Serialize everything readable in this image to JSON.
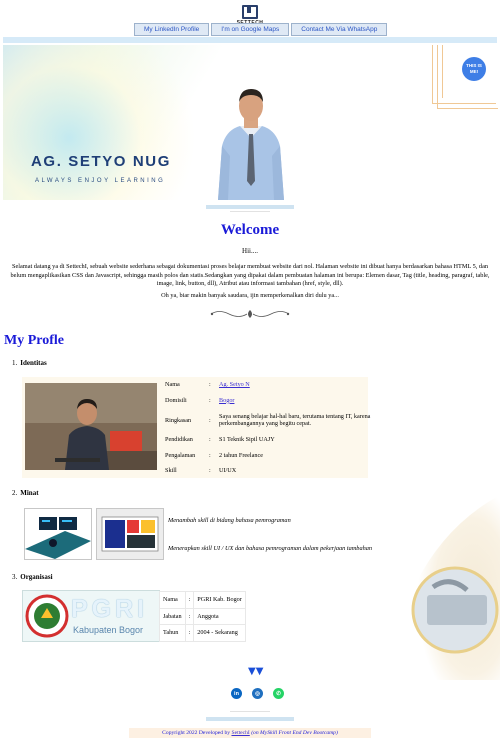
{
  "brand": {
    "logo_text": "SETTECH"
  },
  "topnav": [
    {
      "label": "My LinkedIn Profile"
    },
    {
      "label": "I'm on Google Maps"
    },
    {
      "label": "Contact Me Via WhatsApp"
    }
  ],
  "hero": {
    "name": "AG. SETYO NUG",
    "tagline": "ALWAYS ENJOY LEARNING",
    "badge": "THIS IS ME!"
  },
  "welcome": {
    "title": "Welcome",
    "greeting": "Hii....",
    "paragraph": "Selamat datang ya di SettechI, sebuah website sederhana sebagai dokumentasi proses belajar membuat website dari nol. Halaman website ini dibuat hanya berdasarkan bahasa HTML 5, dan belum mengaplikasikan CSS dan Javascript, sehingga masih polos dan statis.Sedangkan yang dipakai dalam pembuatan halaman ini berupa: Elemen dasar, Tag (title, heading, paragraf, table, image, link, button, dll), Atribut atau informasi tambahan (href, style, dll).",
    "closing": "Oh ya, biar makin banyak saudara, ijin memperkenalkan diri dulu ya..."
  },
  "profile": {
    "title": "My Profle",
    "sections": [
      {
        "num": "1.",
        "title": "Identitas"
      },
      {
        "num": "2.",
        "title": "Minat"
      },
      {
        "num": "3.",
        "title": "Organisasi"
      }
    ],
    "identitas": [
      {
        "key": "Nama",
        "sep": ":",
        "value": "Ag. Setyo N",
        "link": true
      },
      {
        "key": "Domisili",
        "sep": ":",
        "value": "Bogor",
        "link": true
      },
      {
        "key": "Ringkasan",
        "sep": ":",
        "value": "Saya senang belajar hal-hal baru, terutama tentang IT, karena perkembangannya yang begitu cepat.",
        "link": false
      },
      {
        "key": "Pendidikan",
        "sep": ":",
        "value": "S1 Teknik Sipil UAJY",
        "link": false
      },
      {
        "key": "Pengalaman",
        "sep": ":",
        "value": "2 tahun Freelance",
        "link": false
      },
      {
        "key": "Skill",
        "sep": ":",
        "value": "UI/UX",
        "link": false
      }
    ],
    "minat": [
      "Menambah skill di bidang bahasa pemrograman",
      "Menerapkan skill UI / UX dan bahasa pemrograman dalam pekerjaan tambahan"
    ],
    "organisasi": {
      "logo_text": "PGRI",
      "logo_subtext": "Kabupaten Bogor",
      "rows": [
        {
          "key": "Nama",
          "sep": ":",
          "value": "PGRI Kab. Bogor"
        },
        {
          "key": "Jabatan",
          "sep": ":",
          "value": "Anggota"
        },
        {
          "key": "Tahun",
          "sep": ":",
          "value": "2004 - Sekarang"
        }
      ]
    }
  },
  "social": [
    {
      "icon": "linkedin-icon",
      "glyph": "in",
      "color": "#0a66c2"
    },
    {
      "icon": "globe-icon",
      "glyph": "◎",
      "color": "#1f6fbf"
    },
    {
      "icon": "whatsapp-icon",
      "glyph": "✆",
      "color": "#25d366"
    }
  ],
  "footer": {
    "prefix": "Copyright 2022 Developed by ",
    "author": "SettechI",
    "suffix": " (on MySkill Front End Dev Bootcamp)"
  },
  "colors": {
    "heading": "#1a1ad8",
    "link": "#3b2fd1",
    "accent_blue": "#d6eaf8"
  }
}
